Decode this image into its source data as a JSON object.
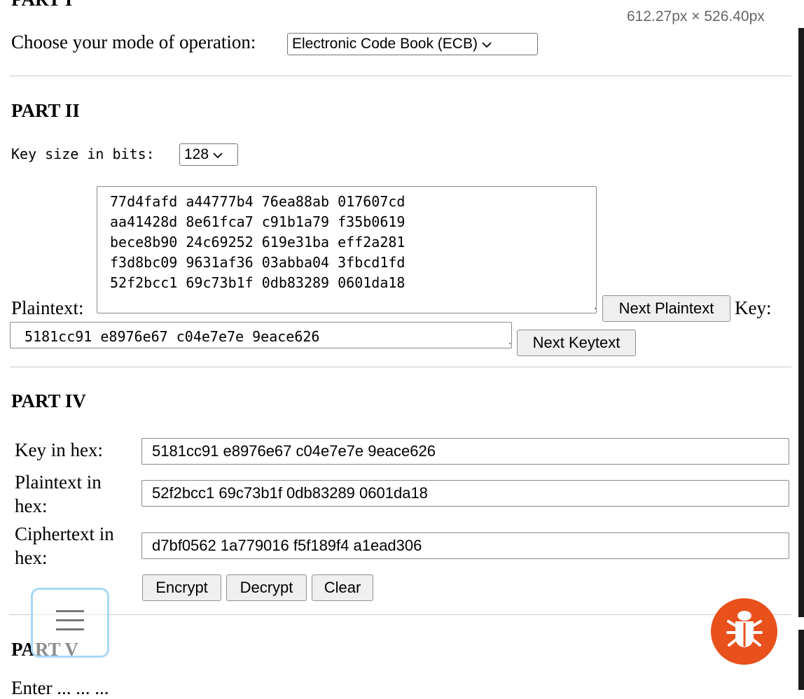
{
  "dimensions_label": "612.27px × 526.40px",
  "part1": {
    "title": "PART I",
    "mode_label": "Choose your mode of operation:",
    "mode_selected": "Electronic Code Book (ECB)"
  },
  "part2": {
    "title": "PART II",
    "key_size_label": "Key size in bits:",
    "key_size_selected": "128",
    "plaintext_label": "Plaintext:",
    "plaintext_value": "77d4fafd a44777b4 76ea88ab 017607cd\naa41428d 8e61fca7 c91b1a79 f35b0619\nbece8b90 24c69252 619e31ba eff2a281\nf3d8bc09 9631af36 03abba04 3fbcd1fd\n52f2bcc1 69c73b1f 0db83289 0601da18",
    "next_plaintext_button": "Next Plaintext",
    "key_label": "Key:",
    "key_value": "5181cc91 e8976e67 c04e7e7e 9eace626",
    "next_keytext_button": "Next Keytext"
  },
  "part4": {
    "title": "PART IV",
    "key_hex_label": "Key in hex:",
    "key_hex_value": "5181cc91 e8976e67 c04e7e7e 9eace626",
    "plaintext_hex_label_1": "Plaintext in",
    "plaintext_hex_label_2": "hex:",
    "plaintext_hex_value": "52f2bcc1 69c73b1f 0db83289 0601da18",
    "ciphertext_hex_label_1": "Ciphertext in",
    "ciphertext_hex_label_2": "hex:",
    "ciphertext_hex_value": "d7bf0562 1a779016 f5f189f4 a1ead306",
    "encrypt_button": "Encrypt",
    "decrypt_button": "Decrypt",
    "clear_button": "Clear"
  },
  "part5": {
    "title": "PART V",
    "partial_text": "Enter ... ...  ..."
  },
  "colors": {
    "bug_button": "#e8501c",
    "menu_border": "#a8d8f5"
  },
  "icons": {
    "menu": "hamburger-menu-icon",
    "bug": "bug-icon",
    "select_arrow": "chevron-down-icon"
  }
}
